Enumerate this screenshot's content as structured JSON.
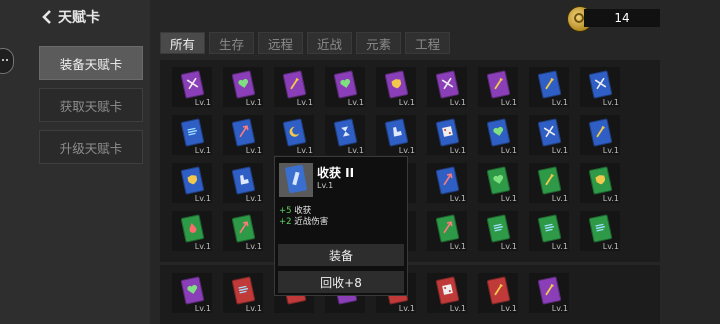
{
  "header": {
    "title": "天赋卡"
  },
  "sidebar": {
    "items": [
      {
        "label": "装备天赋卡",
        "active": true
      },
      {
        "label": "获取天赋卡",
        "active": false
      },
      {
        "label": "升级天赋卡",
        "active": false
      }
    ]
  },
  "currency": {
    "icon": "coin-icon",
    "amount": "14"
  },
  "tabs": [
    {
      "label": "所有",
      "active": true
    },
    {
      "label": "生存",
      "active": false
    },
    {
      "label": "远程",
      "active": false
    },
    {
      "label": "近战",
      "active": false
    },
    {
      "label": "元素",
      "active": false
    },
    {
      "label": "工程",
      "active": false
    }
  ],
  "colors": {
    "purple": "#8a3fb8",
    "blue": "#2f5fc4",
    "green": "#2e9a47",
    "red": "#c03a3a"
  },
  "cards": [
    {
      "color": "purple",
      "icon": "crossed-swords-icon",
      "level": "Lv.1"
    },
    {
      "color": "purple",
      "icon": "heart-icon",
      "level": "Lv.1"
    },
    {
      "color": "purple",
      "icon": "sword-icon",
      "level": "Lv.1"
    },
    {
      "color": "purple",
      "icon": "heart-icon",
      "level": "Lv.1"
    },
    {
      "color": "purple",
      "icon": "shield-icon",
      "level": "Lv.1"
    },
    {
      "color": "purple",
      "icon": "crossed-swords-icon",
      "level": "Lv.1"
    },
    {
      "color": "purple",
      "icon": "sword-icon",
      "level": "Lv.1"
    },
    {
      "color": "blue",
      "icon": "sword-icon",
      "level": "Lv.1"
    },
    {
      "color": "blue",
      "icon": "crossed-swords-icon",
      "level": "Lv.1"
    },
    {
      "color": "blue",
      "icon": "wind-icon",
      "level": "Lv.1"
    },
    {
      "color": "blue",
      "icon": "arrow-icon",
      "level": "Lv.1"
    },
    {
      "color": "blue",
      "icon": "crescent-icon",
      "level": "Lv.1"
    },
    {
      "color": "blue",
      "icon": "hourglass-icon",
      "level": "Lv.1"
    },
    {
      "color": "blue",
      "icon": "boot-icon",
      "level": "Lv.1"
    },
    {
      "color": "blue",
      "icon": "dice-icon",
      "level": "Lv.1"
    },
    {
      "color": "blue",
      "icon": "heart-icon",
      "level": "Lv.1"
    },
    {
      "color": "blue",
      "icon": "crossed-swords-icon",
      "level": "Lv.1"
    },
    {
      "color": "blue",
      "icon": "sword-icon",
      "level": "Lv.1"
    },
    {
      "color": "blue",
      "icon": "shield-icon",
      "level": "Lv.1"
    },
    {
      "color": "blue",
      "icon": "boot-icon",
      "level": "Lv.1"
    },
    {
      "color": "blue",
      "icon": "",
      "level": ""
    },
    {
      "color": "blue",
      "icon": "",
      "level": ""
    },
    {
      "color": "blue",
      "icon": "",
      "level": ""
    },
    {
      "color": "blue",
      "icon": "arrow-icon",
      "level": "Lv.1"
    },
    {
      "color": "green",
      "icon": "heart-icon",
      "level": "Lv.1"
    },
    {
      "color": "green",
      "icon": "sword-icon",
      "level": "Lv.1"
    },
    {
      "color": "green",
      "icon": "shield-icon",
      "level": "Lv.1"
    },
    {
      "color": "green",
      "icon": "drop-icon",
      "level": "Lv.1"
    },
    {
      "color": "green",
      "icon": "arrow-icon",
      "level": "Lv.1"
    },
    {
      "color": "green",
      "icon": "",
      "level": ""
    },
    {
      "color": "green",
      "icon": "",
      "level": ""
    },
    {
      "color": "green",
      "icon": "",
      "level": ""
    },
    {
      "color": "green",
      "icon": "arrow-icon",
      "level": "Lv.1"
    },
    {
      "color": "green",
      "icon": "wind-icon",
      "level": "Lv.1"
    },
    {
      "color": "green",
      "icon": "wind-icon",
      "level": "Lv.1"
    },
    {
      "color": "green",
      "icon": "wind-icon",
      "level": "Lv.1"
    }
  ],
  "equipped": [
    {
      "color": "purple",
      "icon": "heart-icon",
      "level": "Lv.1"
    },
    {
      "color": "red",
      "icon": "wind-icon",
      "level": "Lv.1"
    },
    {
      "color": "red",
      "icon": "",
      "level": ""
    },
    {
      "color": "purple",
      "icon": "",
      "level": ""
    },
    {
      "color": "red",
      "icon": "",
      "level": "Lv.1"
    },
    {
      "color": "red",
      "icon": "dice-icon",
      "level": "Lv.1"
    },
    {
      "color": "red",
      "icon": "sword-icon",
      "level": "Lv.1"
    },
    {
      "color": "purple",
      "icon": "sword-icon",
      "level": "Lv.1"
    }
  ],
  "tooltip": {
    "name": "收获 II",
    "level": "Lv.1",
    "stats": [
      {
        "value": "+5",
        "label": "收获"
      },
      {
        "value": "+2",
        "label": "近战伤害"
      }
    ],
    "equip_label": "装备",
    "recycle_label": "回收+8"
  }
}
